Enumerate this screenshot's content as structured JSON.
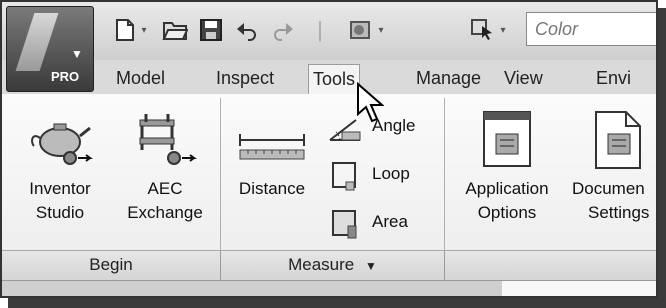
{
  "app": {
    "edition_badge": "PRO",
    "logo_icon": "inventor-logo-icon"
  },
  "quick_access": {
    "icons": [
      "new-file-icon",
      "open-folder-icon",
      "save-icon",
      "undo-icon",
      "redo-icon",
      "appearance-icon",
      "select-icon"
    ],
    "color_field": "Color"
  },
  "tabs": [
    {
      "label": "Model",
      "active": false
    },
    {
      "label": "Inspect",
      "active": false
    },
    {
      "label": "Tools",
      "active": true
    },
    {
      "label": "Manage",
      "active": false
    },
    {
      "label": "View",
      "active": false
    },
    {
      "label": "Envi",
      "active": false
    }
  ],
  "panels": {
    "begin": {
      "title": "Begin",
      "buttons": [
        {
          "line1": "Inventor",
          "line2": "Studio",
          "icon": "teapot-render-icon"
        },
        {
          "line1": "AEC",
          "line2": "Exchange",
          "icon": "aec-exchange-icon"
        }
      ]
    },
    "measure": {
      "title": "Measure",
      "dropdown_glyph": "▼",
      "distance": {
        "label": "Distance",
        "icon": "ruler-distance-icon"
      },
      "small": [
        {
          "label": "Angle",
          "icon": "angle-measure-icon"
        },
        {
          "label": "Loop",
          "icon": "loop-measure-icon"
        },
        {
          "label": "Area",
          "icon": "area-measure-icon"
        }
      ]
    },
    "options": {
      "buttons": [
        {
          "line1": "Application",
          "line2": "Options",
          "icon": "application-options-icon"
        },
        {
          "line1": "Documen",
          "line2": "Settings",
          "icon": "document-settings-icon"
        }
      ]
    }
  }
}
